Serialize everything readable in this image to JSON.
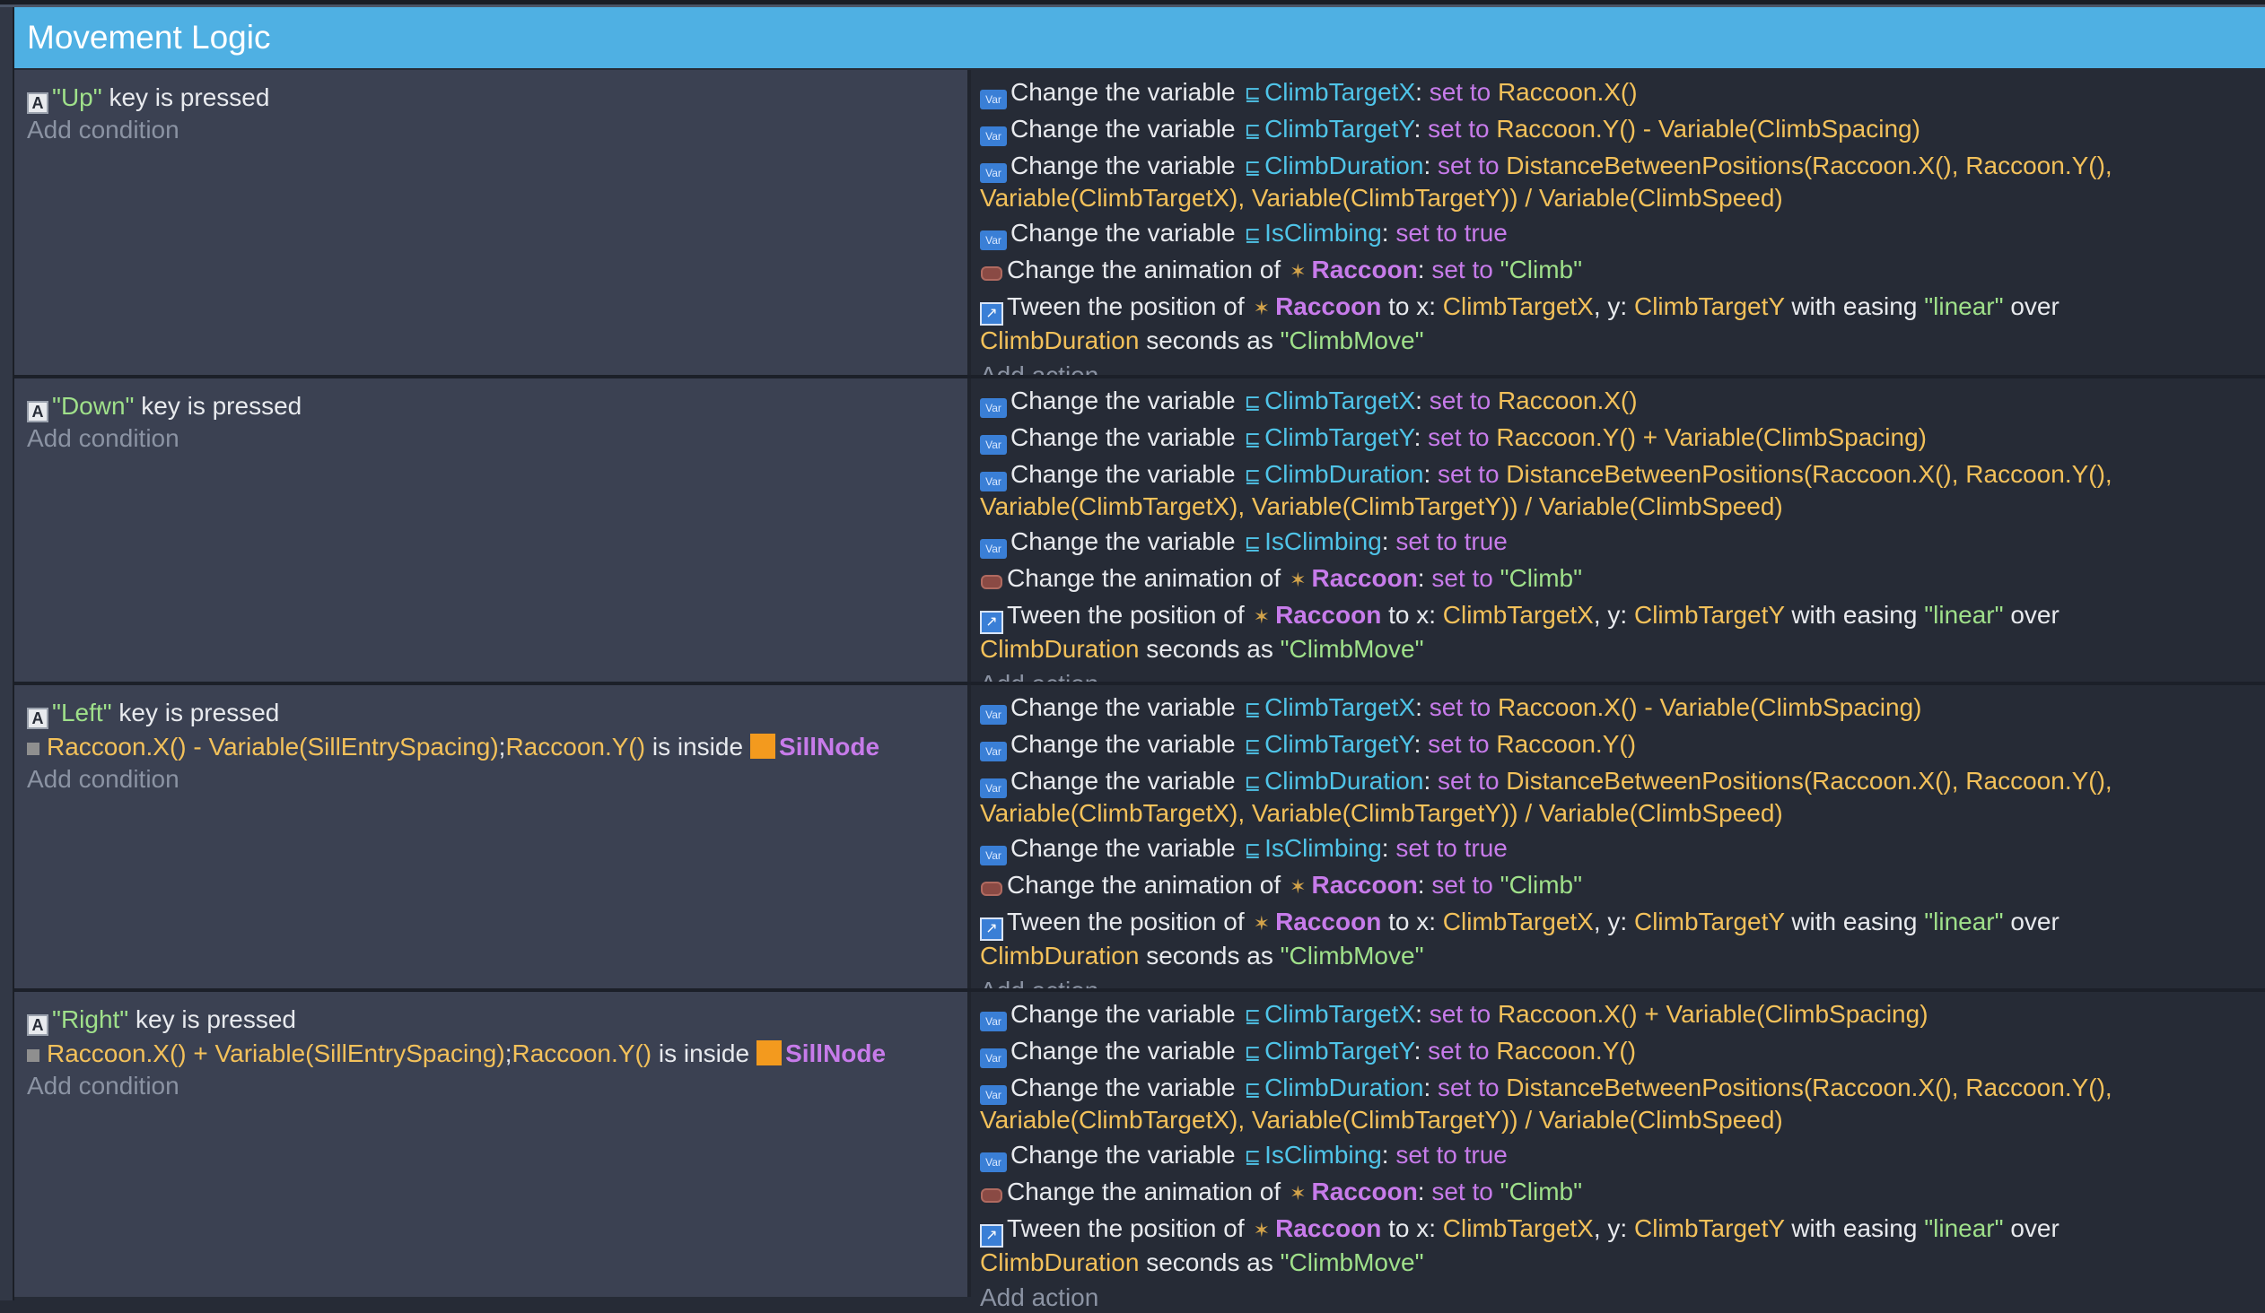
{
  "group": {
    "title": "Movement Logic"
  },
  "labels": {
    "key_is_pressed": "key is pressed",
    "add_condition": "Add condition",
    "add_action": "Add action",
    "change_variable": "Change the variable",
    "change_animation": "Change the animation of",
    "tween_position": "Tween the position of",
    "to_x": "to x:",
    "y": "y:",
    "with_easing": "with easing",
    "over": "over",
    "seconds_as": "seconds as",
    "is_inside": "is inside",
    "colon": ":",
    "set_to": "set to",
    "set_to_true": "set to true",
    "comma": ","
  },
  "names": {
    "climb_target_x": "ClimbTargetX",
    "climb_target_y": "ClimbTargetY",
    "climb_duration": "ClimbDuration",
    "is_climbing": "IsClimbing",
    "raccoon": "Raccoon",
    "sill_node": "SillNode",
    "climb_anim": "\"Climb\"",
    "linear": "\"linear\"",
    "climb_move": "\"ClimbMove\"",
    "raccoon_x": "Raccoon.X()",
    "raccoon_y": "Raccoon.Y()",
    "raccoon_y_minus": "Raccoon.Y() - Variable(ClimbSpacing)",
    "raccoon_y_plus": "Raccoon.Y() + Variable(ClimbSpacing)",
    "raccoon_x_minus": "Raccoon.X() - Variable(ClimbSpacing)",
    "raccoon_x_plus": "Raccoon.X() + Variable(ClimbSpacing)",
    "distance_line1": "DistanceBetweenPositions(Raccoon.X(), Raccoon.Y(),",
    "distance_line2": "Variable(ClimbTargetX), Variable(ClimbTargetY)) / Variable(ClimbSpeed)",
    "sill_x_minus": "Raccoon.X() - Variable(SillEntrySpacing)",
    "sill_x_plus": "Raccoon.X() + Variable(SillEntrySpacing)",
    "sill_y": "Raccoon.Y()",
    "semicolon": ";"
  },
  "events": [
    {
      "key": "\"Up\""
    },
    {
      "key": "\"Down\""
    },
    {
      "key": "\"Left\""
    },
    {
      "key": "\"Right\""
    }
  ],
  "icons": {
    "keyboard": "keyboard-key-icon",
    "variable": "variable-icon",
    "animation": "animation-icon",
    "tween": "tween-icon",
    "sprite": "sprite-object-icon",
    "position": "position-icon",
    "sill": "sill-node-object-icon"
  },
  "colors": {
    "header": "#4fb0e3",
    "condition_bg": "#3b4152",
    "action_bg": "#262b36",
    "string": "#9fe08a",
    "variable": "#4fc4e8",
    "operator": "#c77bea",
    "expression": "#f3c15a",
    "object": "#c77bea"
  }
}
